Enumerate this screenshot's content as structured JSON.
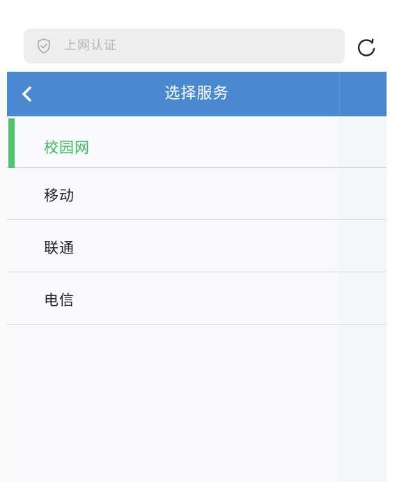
{
  "address_bar": {
    "text": "上网认证",
    "icon": "shield-check-icon"
  },
  "refresh": {
    "icon": "refresh-icon"
  },
  "header": {
    "title": "选择服务",
    "back_icon": "chevron-left-icon"
  },
  "services": [
    {
      "label": "校园网",
      "selected": true
    },
    {
      "label": "移动",
      "selected": false
    },
    {
      "label": "联通",
      "selected": false
    },
    {
      "label": "电信",
      "selected": false
    }
  ],
  "colors": {
    "header_bg": "#4a88cf",
    "selected_text": "#3cb55c",
    "selected_bar": "#4fc66c",
    "address_bg": "#eeeeee"
  }
}
